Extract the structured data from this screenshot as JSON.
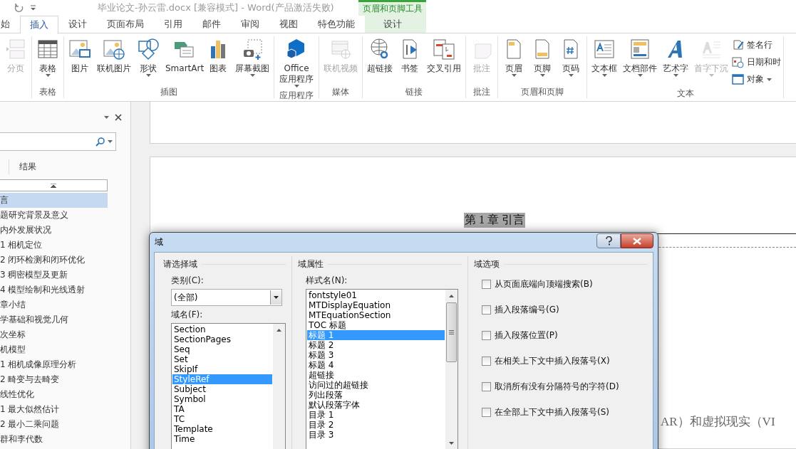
{
  "window": {
    "title": "毕业论文-孙云雷.docx [兼容模式] - Word(产品激活失败)"
  },
  "tabs": [
    {
      "label": "始",
      "selected": false
    },
    {
      "label": "插入",
      "selected": true
    },
    {
      "label": "设计",
      "selected": false
    },
    {
      "label": "页面布局",
      "selected": false
    },
    {
      "label": "引用",
      "selected": false
    },
    {
      "label": "邮件",
      "selected": false
    },
    {
      "label": "审阅",
      "selected": false
    },
    {
      "label": "视图",
      "selected": false
    },
    {
      "label": "特色功能",
      "selected": false
    }
  ],
  "contextual": {
    "title": "页眉和页脚工具",
    "tabs": [
      {
        "label": "设计",
        "selected": false
      }
    ]
  },
  "ribbon": {
    "groups": [
      {
        "buttons": [
          {
            "label": "分页",
            "disabled": true,
            "dropdown": false
          }
        ]
      },
      {
        "label": "表格",
        "buttons": [
          {
            "label": "表格",
            "disabled": false,
            "dropdown": true
          }
        ]
      },
      {
        "label": "插图",
        "buttons": [
          {
            "label": "图片",
            "disabled": false,
            "dropdown": false
          },
          {
            "label": "联机图片",
            "disabled": false,
            "dropdown": false
          },
          {
            "label": "形状",
            "disabled": false,
            "dropdown": true
          },
          {
            "label": "SmartArt",
            "disabled": false,
            "dropdown": false
          },
          {
            "label": "图表",
            "disabled": false,
            "dropdown": false
          },
          {
            "label": "屏幕截图",
            "disabled": false,
            "dropdown": true
          }
        ]
      },
      {
        "label": "应用程序",
        "buttons": [
          {
            "label": "Office 应用程序",
            "disabled": false,
            "dropdown": true
          }
        ]
      },
      {
        "label": "媒体",
        "buttons": [
          {
            "label": "联机视频",
            "disabled": true,
            "dropdown": false
          }
        ]
      },
      {
        "label": "链接",
        "buttons": [
          {
            "label": "超链接",
            "disabled": false,
            "dropdown": false
          },
          {
            "label": "书签",
            "disabled": false,
            "dropdown": false
          },
          {
            "label": "交叉引用",
            "disabled": false,
            "dropdown": false
          }
        ]
      },
      {
        "label": "批注",
        "buttons": [
          {
            "label": "批注",
            "disabled": true,
            "dropdown": false
          }
        ]
      },
      {
        "label": "页眉和页脚",
        "buttons": [
          {
            "label": "页眉",
            "disabled": false,
            "dropdown": true
          },
          {
            "label": "页脚",
            "disabled": false,
            "dropdown": true
          },
          {
            "label": "页码",
            "disabled": false,
            "dropdown": true
          }
        ]
      },
      {
        "label": "文本",
        "buttons": [
          {
            "label": "文本框",
            "disabled": false,
            "dropdown": true
          },
          {
            "label": "文档部件",
            "disabled": false,
            "dropdown": true
          },
          {
            "label": "艺术字",
            "disabled": false,
            "dropdown": true
          },
          {
            "label": "首字下沉",
            "disabled": true,
            "dropdown": true
          }
        ],
        "small_buttons": [
          {
            "label": "签名行",
            "dropdown": false
          },
          {
            "label": "日期和时",
            "dropdown": false
          },
          {
            "label": "对象",
            "dropdown": true
          }
        ]
      }
    ]
  },
  "nav": {
    "tabs": [
      {
        "label": "结果",
        "selected": false
      }
    ],
    "items": [
      {
        "label": "言",
        "selected": true
      },
      {
        "label": "题研究背景及意义",
        "selected": false
      },
      {
        "label": "内外发展状况",
        "selected": false
      },
      {
        "label": "1 相机定位",
        "selected": false
      },
      {
        "label": "2 闭环检测和闭环优化",
        "selected": false
      },
      {
        "label": "3 稠密模型及更新",
        "selected": false
      },
      {
        "label": "4 模型绘制和光线透射",
        "selected": false
      },
      {
        "label": "章小结",
        "selected": false
      },
      {
        "label": "学基础和视觉几何",
        "selected": false
      },
      {
        "label": "次坐标",
        "selected": false
      },
      {
        "label": "机模型",
        "selected": false
      },
      {
        "label": "1 相机成像原理分析",
        "selected": false
      },
      {
        "label": "2 畸变与去畸变",
        "selected": false
      },
      {
        "label": "线性优化",
        "selected": false
      },
      {
        "label": "1 最大似然估计",
        "selected": false
      },
      {
        "label": "2 最小二乘问题",
        "selected": false
      },
      {
        "label": "群和李代数",
        "selected": false
      }
    ]
  },
  "document": {
    "header_text": "第 1 章 引言",
    "body_text": "AR）和虚拟现实（VI"
  },
  "dialog": {
    "title": "域",
    "choose": {
      "heading": "请选择域",
      "category_label": "类别(C):",
      "category_value": "(全部)",
      "names_label": "域名(F):",
      "names": [
        {
          "label": "Section",
          "selected": false
        },
        {
          "label": "SectionPages",
          "selected": false
        },
        {
          "label": "Seq",
          "selected": false
        },
        {
          "label": "Set",
          "selected": false
        },
        {
          "label": "SkipIf",
          "selected": false
        },
        {
          "label": "StyleRef",
          "selected": true
        },
        {
          "label": "Subject",
          "selected": false
        },
        {
          "label": "Symbol",
          "selected": false
        },
        {
          "label": "TA",
          "selected": false
        },
        {
          "label": "TC",
          "selected": false
        },
        {
          "label": "Template",
          "selected": false
        },
        {
          "label": "Time",
          "selected": false
        }
      ]
    },
    "properties": {
      "heading": "域属性",
      "style_label": "样式名(N):",
      "styles": [
        {
          "label": "fontstyle01",
          "selected": false
        },
        {
          "label": "MTDisplayEquation",
          "selected": false
        },
        {
          "label": "MTEquationSection",
          "selected": false
        },
        {
          "label": "TOC 标题",
          "selected": false
        },
        {
          "label": "标题 1",
          "selected": true
        },
        {
          "label": "标题 2",
          "selected": false
        },
        {
          "label": "标题 3",
          "selected": false
        },
        {
          "label": "标题 4",
          "selected": false
        },
        {
          "label": "超链接",
          "selected": false
        },
        {
          "label": "访问过的超链接",
          "selected": false
        },
        {
          "label": "列出段落",
          "selected": false
        },
        {
          "label": "默认段落字体",
          "selected": false
        },
        {
          "label": "目录 1",
          "selected": false
        },
        {
          "label": "目录 2",
          "selected": false
        },
        {
          "label": "目录 3",
          "selected": false
        }
      ]
    },
    "options": {
      "heading": "域选项",
      "items": [
        {
          "label": "从页面底端向顶端搜索(B)",
          "checked": false
        },
        {
          "label": "插入段落编号(G)",
          "checked": false
        },
        {
          "label": "插入段落位置(P)",
          "checked": false
        },
        {
          "label": "在相关上下文中插入段落号(X)",
          "checked": false
        },
        {
          "label": "取消所有没有分隔符号的字符(D)",
          "checked": false
        },
        {
          "label": "在全部上下文中插入段落号(S)",
          "checked": false
        }
      ]
    }
  }
}
